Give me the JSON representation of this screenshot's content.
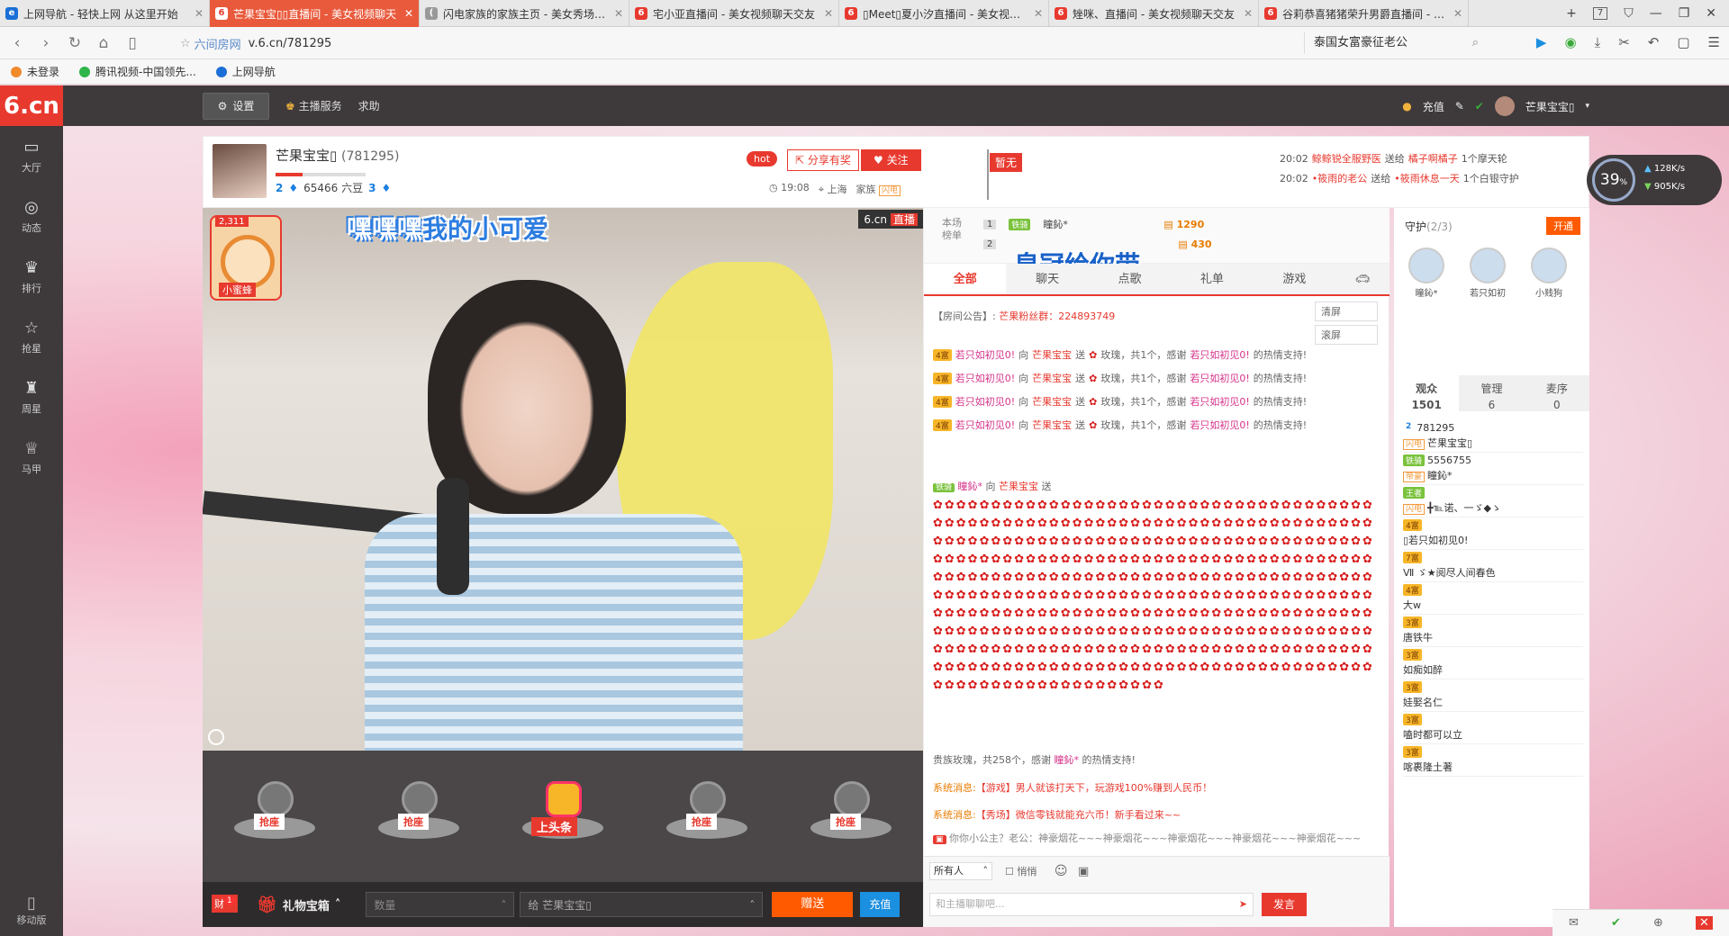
{
  "browser": {
    "tabs": [
      {
        "label": "上网导航 - 轻快上网 从这里开始",
        "icon": "ie-icon",
        "active": false
      },
      {
        "label": "芒果宝宝▯▯直播间 - 美女视频聊天",
        "icon": "six-icon",
        "active": true
      },
      {
        "label": "闪电家族的家族主页 - 美女秀场直播",
        "icon": "paren-icon",
        "active": false
      },
      {
        "label": "宅小亚直播间 - 美女视频聊天交友",
        "icon": "six-icon",
        "active": false
      },
      {
        "label": "▯Meet▯夏小汐直播间 - 美女视频聊",
        "icon": "six-icon",
        "active": false
      },
      {
        "label": "矬咪、直播间 - 美女视频聊天交友",
        "icon": "six-icon",
        "active": false
      },
      {
        "label": "谷莉恭喜猪猪荣升男爵直播间 - 美女",
        "icon": "six-icon",
        "active": false
      }
    ],
    "tab_count": "7",
    "address": {
      "site_label": "六间房网",
      "url": "v.6.cn/781295"
    },
    "search_text": "泰国女富豪征老公",
    "bookmarks": [
      "未登录",
      "腾讯视频-中国领先...",
      "上网导航"
    ]
  },
  "topnav": {
    "logo": "6.cn",
    "settings": "设置",
    "host_service": "主播服务",
    "help": "求助",
    "recharge": "充值",
    "user": "芒果宝宝▯"
  },
  "sidebar": {
    "items": [
      {
        "label": "大厅",
        "icon": "tv-icon"
      },
      {
        "label": "动态",
        "icon": "compass-icon"
      },
      {
        "label": "排行",
        "icon": "crown-icon"
      },
      {
        "label": "抢星",
        "icon": "star-icon"
      },
      {
        "label": "周星",
        "icon": "trophy-icon"
      },
      {
        "label": "马甲",
        "icon": "vest-icon"
      }
    ],
    "mobile": "移动版"
  },
  "host": {
    "name": "芒果宝宝▯",
    "id": "(781295)",
    "level_a": "2",
    "beans": "65466 六豆",
    "level_b": "3",
    "level_progress": 0.3,
    "hot": "hot",
    "share": "分享有奖",
    "follow": "关注",
    "time": "19:08",
    "city": "上海",
    "family_label": "家族",
    "family_tag": "闪电",
    "flag": "暂无"
  },
  "gift_feed": [
    {
      "time": "20:02",
      "from": "鲸鲸锐全服野医",
      "verb": "送给",
      "to": "橘子啊橘子",
      "gift": "1个摩天轮"
    },
    {
      "time": "20:02",
      "from": "•筱雨的老公",
      "verb": "送给",
      "to": "•筱雨休息一天",
      "gift": "1个白银守护"
    }
  ],
  "speed": {
    "percent": "39",
    "percent_sign": "%",
    "up": "128K/s",
    "down": "905K/s"
  },
  "video": {
    "caption_a": "嘿嘿嘿",
    "caption_b": "我的小可爱",
    "brand": "6.cn",
    "live": "直播",
    "fire_count": "2,311",
    "fire_label": "小蜜蜂"
  },
  "seats": [
    "抢座",
    "抢座",
    "上头条",
    "抢座",
    "抢座"
  ],
  "bottombar": {
    "badge": "财",
    "badge_count": "1",
    "gift_box": "礼物宝箱",
    "qty_placeholder": "数量",
    "to_prefix": "给",
    "to_name": "芒果宝宝▯",
    "send": "赠送",
    "charge": "充值"
  },
  "rank": {
    "title": "本场榜单",
    "rows": [
      {
        "n": "1",
        "lv": "铁骑",
        "name": "瞳鈊*",
        "coins": "1290"
      },
      {
        "n": "2",
        "lv": "",
        "name": "",
        "coins": "430"
      }
    ],
    "crown_text": "皇冠给你带"
  },
  "chat_tabs": [
    "全部",
    "聊天",
    "点歌",
    "礼单",
    "游戏"
  ],
  "notice": {
    "label": "【房间公告】:",
    "text": "芒果粉丝群：224893749"
  },
  "messages": [
    {
      "lv": "4富",
      "user": "若只如初见0!",
      "to": "向",
      "anchor": "芒果宝宝",
      "send": "送",
      "gift": "玫瑰，共1个，感谢",
      "thanks": "若只如初见0!",
      "end": "的热情支持!"
    },
    {
      "lv": "4富",
      "user": "若只如初见0!",
      "to": "向",
      "anchor": "芒果宝宝",
      "send": "送",
      "gift": "玫瑰，共1个，感谢",
      "thanks": "若只如初见0!",
      "end": "的热情支持!"
    },
    {
      "lv": "4富",
      "user": "若只如初见0!",
      "to": "向",
      "anchor": "芒果宝宝",
      "send": "送",
      "gift": "玫瑰，共1个，感谢",
      "thanks": "若只如初见0!",
      "end": "的热情支持!"
    },
    {
      "lv": "4富",
      "user": "若只如初见0!",
      "to": "向",
      "anchor": "芒果宝宝",
      "send": "送",
      "gift": "玫瑰，共1个，感谢",
      "thanks": "若只如初见0!",
      "end": "的热情支持!"
    }
  ],
  "big_gift": {
    "lv": "铁骑",
    "user": "瞳鈊*",
    "to": "向",
    "anchor": "芒果宝宝",
    "send": "送",
    "summary": "贵族玫瑰，共258个，感谢",
    "thanks": "瞳鈊*",
    "end": "的热情支持!"
  },
  "chat_tools": [
    "清屏",
    "滚屏"
  ],
  "system_messages": [
    {
      "label": "系统消息:",
      "tag": "【游戏】",
      "text": "男人就该打天下，玩游戏100%赚到人民币！"
    },
    {
      "label": "系统消息:",
      "tag": "【秀场】",
      "text": "微信零钱就能充六币！新手看过来~~"
    }
  ],
  "last_msg": "你你小公主？老公：神豪烟花~~~神豪烟花~~~神豪烟花~~~神豪烟花~~~神豪烟花~~~",
  "chat_input": {
    "to": "所有人",
    "whisper": "悄悄",
    "placeholder": "和主播聊聊吧...",
    "speak": "发言"
  },
  "guard": {
    "title": "守护",
    "count": "(2/3)",
    "open": "开通",
    "members": [
      "瞳鈊*",
      "若只如初",
      "小贱狗"
    ]
  },
  "audience_tabs": [
    {
      "label": "观众",
      "count": "1501"
    },
    {
      "label": "管理",
      "count": "6"
    },
    {
      "label": "麦序",
      "count": "0"
    }
  ],
  "audience": [
    {
      "badge": "2",
      "id": "781295",
      "tag": "闪电",
      "name": "芒果宝宝▯"
    },
    {
      "badge": "铁骑",
      "id": "5556755",
      "tag": "帝豪",
      "name": "瞳鈊*"
    },
    {
      "badge": "王者",
      "id": "",
      "tag": "闪电",
      "name": "╋℡诺、一ゞ◆ゝ"
    },
    {
      "badge": "4富",
      "id": "",
      "tag": "",
      "name": "▯若只如初见0!"
    },
    {
      "badge": "7富",
      "id": "",
      "tag": "",
      "name": "Ⅶ ゞ★阅尽人间春色"
    },
    {
      "badge": "4富",
      "id": "",
      "tag": "",
      "name": "大w"
    },
    {
      "badge": "3富",
      "id": "",
      "tag": "",
      "name": "唐铁牛"
    },
    {
      "badge": "3富",
      "id": "",
      "tag": "",
      "name": "如痴如醉"
    },
    {
      "badge": "3富",
      "id": "",
      "tag": "",
      "name": "娃娶名仁"
    },
    {
      "badge": "3富",
      "id": "",
      "tag": "",
      "name": "嗑时都可以立"
    },
    {
      "badge": "3富",
      "id": "",
      "tag": "",
      "name": "喀裹隆土著"
    }
  ],
  "colors": {
    "brand_red": "#e8392f",
    "accent_orange": "#ff5a00",
    "blue": "#1b8fe0"
  }
}
